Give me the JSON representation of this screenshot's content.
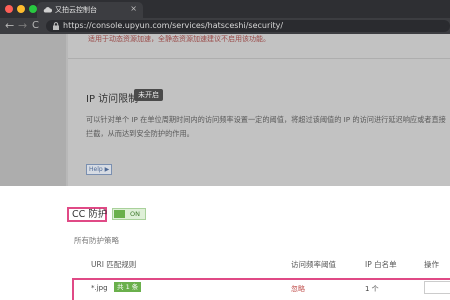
{
  "browser": {
    "tab_title": "又拍云控制台",
    "url": "https://console.upyun.com/services/hatsceshi/security/",
    "tab_close": "×",
    "nav_back": "←",
    "nav_forward": "→",
    "nav_reload": "C",
    "colors": {
      "titlebar": "#2e2f33",
      "toolbar": "#3c3d41"
    }
  },
  "background_panel": {
    "note": "适用于动态资源加速，全静态资源加速建议不启用该功能。",
    "ip_limit": {
      "title": "IP 访问限制",
      "status": "未开启",
      "description": "可以针对单个 IP 在单位周期时间内的访问频率设置一定的阈值，将超过该阈值的 IP 的访问进行延迟响应或者直接拦截，从而达到安全防护的作用。",
      "help_label": "Help ▶"
    }
  },
  "cc": {
    "title": "CC 防护",
    "toggle_label": "ON",
    "toggle_on": true,
    "section_label": "所有防护策略",
    "table": {
      "headers": [
        "URI 匹配规则",
        "访问频率阈值",
        "IP 白名单",
        "操作"
      ],
      "rows": [
        {
          "uri": "*.jpg",
          "rule_count": "共 1 条",
          "frequency": "忽略",
          "ip_whitelist": "1 个"
        }
      ]
    },
    "highlight_color": "#e04a86"
  }
}
